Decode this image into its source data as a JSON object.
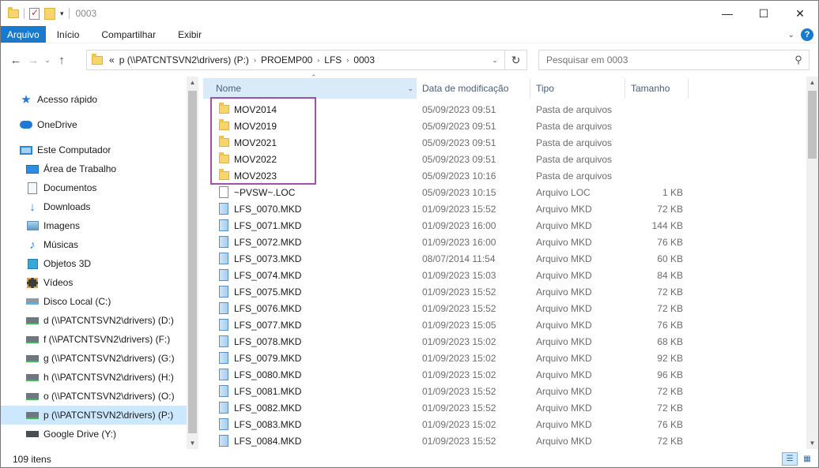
{
  "window": {
    "title": "0003"
  },
  "quick_access_toolbar": {
    "icons": [
      "folder-icon",
      "properties-icon",
      "new-folder-icon",
      "customize-dropdown-icon"
    ]
  },
  "window_controls": {
    "minimize": "—",
    "maximize": "☐",
    "close": "✕"
  },
  "ribbon": {
    "tabs": [
      "Arquivo",
      "Início",
      "Compartilhar",
      "Exibir"
    ],
    "expand_glyph": "⌄",
    "help_glyph": "?"
  },
  "nav": {
    "back_glyph": "←",
    "forward_glyph": "→",
    "recent_glyph": "⌄",
    "up_glyph": "↑",
    "overflow_glyph": "«",
    "breadcrumbs": [
      "p (\\\\PATCNTSVN2\\drivers) (P:)",
      "PROEMP00",
      "LFS",
      "0003"
    ],
    "crumb_separator": "›",
    "dropdown_glyph": "⌄",
    "refresh_glyph": "↻"
  },
  "search": {
    "placeholder": "Pesquisar em 0003",
    "icon_glyph": "⚲"
  },
  "sidebar": {
    "items": [
      {
        "label": "Acesso rápido",
        "icon": "star-icon"
      },
      {
        "label": "OneDrive",
        "icon": "cloud-icon"
      },
      {
        "label": "Este Computador",
        "icon": "computer-icon"
      },
      {
        "label": "Área de Trabalho",
        "icon": "desktop-icon"
      },
      {
        "label": "Documentos",
        "icon": "documents-icon"
      },
      {
        "label": "Downloads",
        "icon": "downloads-icon"
      },
      {
        "label": "Imagens",
        "icon": "pictures-icon"
      },
      {
        "label": "Músicas",
        "icon": "music-icon"
      },
      {
        "label": "Objetos 3D",
        "icon": "3d-objects-icon"
      },
      {
        "label": "Vídeos",
        "icon": "videos-icon"
      },
      {
        "label": "Disco Local (C:)",
        "icon": "local-disk-icon"
      },
      {
        "label": "d (\\\\PATCNTSVN2\\drivers) (D:)",
        "icon": "network-drive-icon"
      },
      {
        "label": "f (\\\\PATCNTSVN2\\drivers) (F:)",
        "icon": "network-drive-icon"
      },
      {
        "label": "g (\\\\PATCNTSVN2\\drivers) (G:)",
        "icon": "network-drive-icon"
      },
      {
        "label": "h (\\\\PATCNTSVN2\\drivers) (H:)",
        "icon": "network-drive-icon"
      },
      {
        "label": "o (\\\\PATCNTSVN2\\drivers) (O:)",
        "icon": "network-drive-icon"
      },
      {
        "label": "p (\\\\PATCNTSVN2\\drivers) (P:)",
        "icon": "network-drive-icon",
        "selected": true
      },
      {
        "label": "Google Drive (Y:)",
        "icon": "google-drive-icon"
      }
    ]
  },
  "columns": {
    "name": "Nome",
    "date": "Data de modificação",
    "type": "Tipo",
    "size": "Tamanho",
    "sort_glyph": "⌃",
    "dropdown_glyph": "⌄"
  },
  "files": [
    {
      "name": "MOV2014",
      "date": "05/09/2023 09:51",
      "type": "Pasta de arquivos",
      "size": "",
      "kind": "folder"
    },
    {
      "name": "MOV2019",
      "date": "05/09/2023 09:51",
      "type": "Pasta de arquivos",
      "size": "",
      "kind": "folder"
    },
    {
      "name": "MOV2021",
      "date": "05/09/2023 09:51",
      "type": "Pasta de arquivos",
      "size": "",
      "kind": "folder"
    },
    {
      "name": "MOV2022",
      "date": "05/09/2023 09:51",
      "type": "Pasta de arquivos",
      "size": "",
      "kind": "folder"
    },
    {
      "name": "MOV2023",
      "date": "05/09/2023 10:16",
      "type": "Pasta de arquivos",
      "size": "",
      "kind": "folder"
    },
    {
      "name": "~PVSW~.LOC",
      "date": "05/09/2023 10:15",
      "type": "Arquivo LOC",
      "size": "1 KB",
      "kind": "blank"
    },
    {
      "name": "LFS_0070.MKD",
      "date": "01/09/2023 15:52",
      "type": "Arquivo MKD",
      "size": "72 KB",
      "kind": "mkd"
    },
    {
      "name": "LFS_0071.MKD",
      "date": "01/09/2023 16:00",
      "type": "Arquivo MKD",
      "size": "144 KB",
      "kind": "mkd"
    },
    {
      "name": "LFS_0072.MKD",
      "date": "01/09/2023 16:00",
      "type": "Arquivo MKD",
      "size": "76 KB",
      "kind": "mkd"
    },
    {
      "name": "LFS_0073.MKD",
      "date": "08/07/2014 11:54",
      "type": "Arquivo MKD",
      "size": "60 KB",
      "kind": "mkd"
    },
    {
      "name": "LFS_0074.MKD",
      "date": "01/09/2023 15:03",
      "type": "Arquivo MKD",
      "size": "84 KB",
      "kind": "mkd"
    },
    {
      "name": "LFS_0075.MKD",
      "date": "01/09/2023 15:52",
      "type": "Arquivo MKD",
      "size": "72 KB",
      "kind": "mkd"
    },
    {
      "name": "LFS_0076.MKD",
      "date": "01/09/2023 15:52",
      "type": "Arquivo MKD",
      "size": "72 KB",
      "kind": "mkd"
    },
    {
      "name": "LFS_0077.MKD",
      "date": "01/09/2023 15:05",
      "type": "Arquivo MKD",
      "size": "76 KB",
      "kind": "mkd"
    },
    {
      "name": "LFS_0078.MKD",
      "date": "01/09/2023 15:02",
      "type": "Arquivo MKD",
      "size": "68 KB",
      "kind": "mkd"
    },
    {
      "name": "LFS_0079.MKD",
      "date": "01/09/2023 15:02",
      "type": "Arquivo MKD",
      "size": "92 KB",
      "kind": "mkd"
    },
    {
      "name": "LFS_0080.MKD",
      "date": "01/09/2023 15:02",
      "type": "Arquivo MKD",
      "size": "96 KB",
      "kind": "mkd"
    },
    {
      "name": "LFS_0081.MKD",
      "date": "01/09/2023 15:52",
      "type": "Arquivo MKD",
      "size": "72 KB",
      "kind": "mkd"
    },
    {
      "name": "LFS_0082.MKD",
      "date": "01/09/2023 15:52",
      "type": "Arquivo MKD",
      "size": "72 KB",
      "kind": "mkd"
    },
    {
      "name": "LFS_0083.MKD",
      "date": "01/09/2023 15:02",
      "type": "Arquivo MKD",
      "size": "76 KB",
      "kind": "mkd"
    },
    {
      "name": "LFS_0084.MKD",
      "date": "01/09/2023 15:52",
      "type": "Arquivo MKD",
      "size": "72 KB",
      "kind": "mkd"
    }
  ],
  "statusbar": {
    "item_count": "109 itens",
    "view_details_glyph": "☰",
    "view_tiles_glyph": "▦"
  },
  "colors": {
    "accent": "#1979ca",
    "selection": "#cce8ff",
    "annotation_box": "#a24fa8",
    "column_header_text": "#4c607a"
  }
}
